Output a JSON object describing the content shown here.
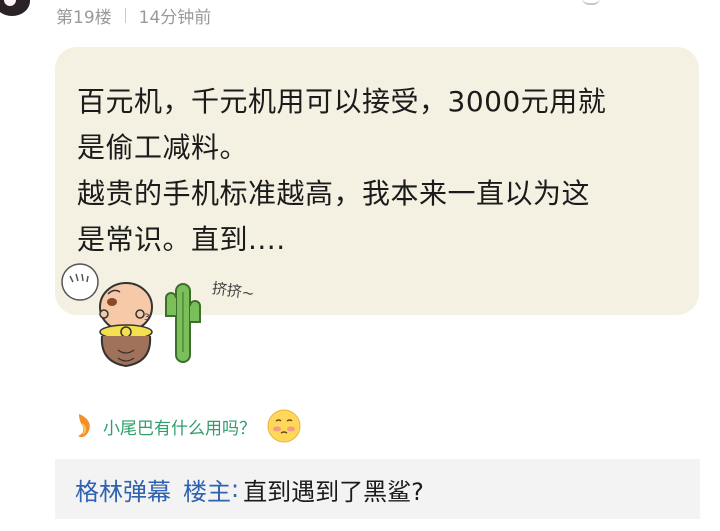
{
  "header": {
    "floor": "第19楼",
    "time": "14分钟前"
  },
  "post": {
    "lines": [
      "百元机，千元机用可以接受，3000元用就",
      "是偷工减料。",
      "越贵的手机标准越高，我本来一直以为这",
      "是常识。直到...."
    ],
    "sticker_caption": "挤挤~"
  },
  "tail": {
    "text": "小尾巴有什么用吗？",
    "accent_color": "#2e9e6a",
    "icon": "flame-icon",
    "emoji": "blushing-face-icon"
  },
  "reply": {
    "author": "格林弹幕",
    "owner_badge": "楼主",
    "separator": ":",
    "text": "直到遇到了黑鲨?"
  },
  "colors": {
    "bubble_bg": "#f4f0e2",
    "link_blue": "#2f62b0",
    "meta_gray": "#9a9a9a",
    "reply_bg": "#f3f3f3"
  }
}
